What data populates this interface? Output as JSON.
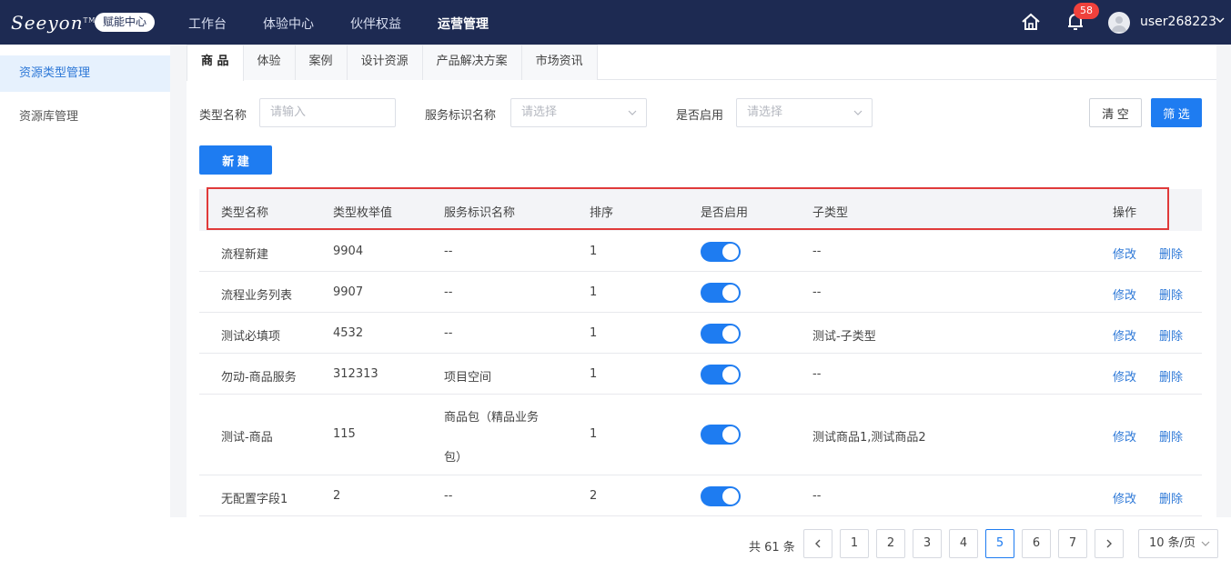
{
  "topbar": {
    "logo_text": "Seeyon",
    "logo_tm": "TM",
    "logo_badge": "赋能中心",
    "nav": [
      {
        "label": "工作台",
        "active": false
      },
      {
        "label": "体验中心",
        "active": false
      },
      {
        "label": "伙伴权益",
        "active": false
      },
      {
        "label": "运营管理",
        "active": true
      }
    ],
    "notification_count": "58",
    "username": "user268223"
  },
  "sidebar": {
    "items": [
      {
        "label": "资源类型管理",
        "active": true
      },
      {
        "label": "资源库管理",
        "active": false
      }
    ]
  },
  "tabs": [
    {
      "label": "商 品",
      "active": true
    },
    {
      "label": "体验",
      "active": false
    },
    {
      "label": "案例",
      "active": false
    },
    {
      "label": "设计资源",
      "active": false
    },
    {
      "label": "产品解决方案",
      "active": false
    },
    {
      "label": "市场资讯",
      "active": false
    }
  ],
  "filters": {
    "type_name_label": "类型名称",
    "type_name_placeholder": "请输入",
    "service_label": "服务标识名称",
    "service_placeholder": "请选择",
    "enabled_label": "是否启用",
    "enabled_placeholder": "请选择",
    "clear_label": "清 空",
    "filter_label": "筛 选"
  },
  "new_button": "新 建",
  "table": {
    "headers": [
      "类型名称",
      "类型枚举值",
      "服务标识名称",
      "排序",
      "是否启用",
      "子类型",
      "操作"
    ],
    "rows": [
      {
        "name": "流程新建",
        "enum": "9904",
        "service": "--",
        "sort": "1",
        "enabled": true,
        "subtype": "--"
      },
      {
        "name": "流程业务列表",
        "enum": "9907",
        "service": "--",
        "sort": "1",
        "enabled": true,
        "subtype": "--"
      },
      {
        "name": "测试必填项",
        "enum": "4532",
        "service": "--",
        "sort": "1",
        "enabled": true,
        "subtype": "测试-子类型"
      },
      {
        "name": "勿动-商品服务",
        "enum": "312313",
        "service": "项目空间",
        "sort": "1",
        "enabled": true,
        "subtype": "--"
      },
      {
        "name": "测试-商品",
        "enum": "115",
        "service_line1": "商品包（精品业务",
        "service_line2": "包）",
        "sort": "1",
        "enabled": true,
        "subtype": "测试商品1,测试商品2"
      },
      {
        "name": "无配置字段1",
        "enum": "2",
        "service": "--",
        "sort": "2",
        "enabled": true,
        "subtype": "--"
      }
    ],
    "edit_label": "修改",
    "delete_label": "删除"
  },
  "pagination": {
    "total_text": "共 61 条",
    "pages": [
      "1",
      "2",
      "3",
      "4",
      "5",
      "6",
      "7"
    ],
    "current_page": "5",
    "page_size": "10 条/页",
    "prev_icon": "chevron-left-icon",
    "next_icon": "chevron-right-icon"
  },
  "colors": {
    "nav_bg": "#1d2a52",
    "primary": "#1e7cf1",
    "link": "#2d78d7",
    "highlight_box": "#e03a3a",
    "badge": "#f0413c"
  }
}
